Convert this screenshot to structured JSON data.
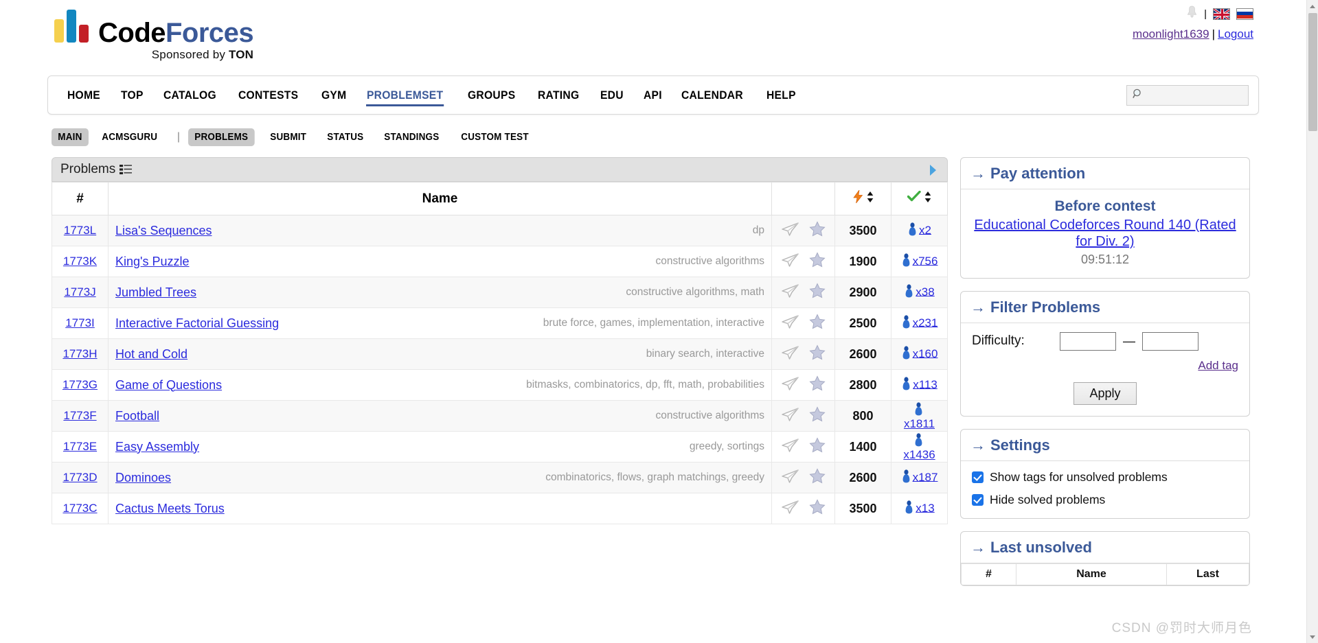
{
  "brand": {
    "name_code": "Code",
    "name_forces": "Forces",
    "sponsor_prefix": "Sponsored by ",
    "sponsor_name": "TON",
    "colors": {
      "yellow": "#f5d04e",
      "blue": "#1287c0",
      "red": "#c32027",
      "forces_blue": "#3b5998"
    }
  },
  "user": {
    "bell_icon": "bell-icon",
    "flag_en": "uk-flag-icon",
    "flag_ru": "russia-flag-icon",
    "username": "moonlight1639",
    "separator": "|",
    "logout": "Logout"
  },
  "nav": {
    "items": [
      {
        "label": "HOME",
        "active": false
      },
      {
        "label": "TOP",
        "active": false
      },
      {
        "label": "CATALOG",
        "active": false
      },
      {
        "label": "CONTESTS",
        "active": false
      },
      {
        "label": "GYM",
        "active": false
      },
      {
        "label": "PROBLEMSET",
        "active": true
      },
      {
        "label": "GROUPS",
        "active": false
      },
      {
        "label": "RATING",
        "active": false
      },
      {
        "label": "EDU",
        "active": false
      },
      {
        "label": "API",
        "active": false
      },
      {
        "label": "CALENDAR",
        "active": false
      },
      {
        "label": "HELP",
        "active": false
      }
    ],
    "search": {
      "placeholder": "",
      "value": "",
      "icon": "search-icon"
    }
  },
  "subnav": {
    "left": [
      {
        "label": "MAIN",
        "selected": true
      },
      {
        "label": "ACMSGURU",
        "selected": false
      }
    ],
    "divider": "|",
    "right": [
      {
        "label": "PROBLEMS",
        "selected": true
      },
      {
        "label": "SUBMIT",
        "selected": false
      },
      {
        "label": "STATUS",
        "selected": false
      },
      {
        "label": "STANDINGS",
        "selected": false
      },
      {
        "label": "CUSTOM TEST",
        "selected": false
      }
    ]
  },
  "problems_panel": {
    "caption": "Problems",
    "caption_icon": "list-icon",
    "next_arrow_icon": "play-arrow-icon",
    "columns": {
      "id": "#",
      "name": "Name",
      "actions": "",
      "difficulty_icon": "lightning-icon",
      "solved_icon": "green-check-icon",
      "sort_icon": "sort-updown-icon"
    },
    "rows": [
      {
        "id": "1773L",
        "name": "Lisa's Sequences",
        "tags": "dp",
        "difficulty": "3500",
        "solved": "x2",
        "stacked": false
      },
      {
        "id": "1773K",
        "name": "King's Puzzle",
        "tags": "constructive algorithms",
        "difficulty": "1900",
        "solved": "x756",
        "stacked": false
      },
      {
        "id": "1773J",
        "name": "Jumbled Trees",
        "tags": "constructive algorithms, math",
        "difficulty": "2900",
        "solved": "x38",
        "stacked": false
      },
      {
        "id": "1773I",
        "name": "Interactive Factorial Guessing",
        "tags": "brute force, games, implementation, interactive",
        "difficulty": "2500",
        "solved": "x231",
        "stacked": false
      },
      {
        "id": "1773H",
        "name": "Hot and Cold",
        "tags": "binary search, interactive",
        "difficulty": "2600",
        "solved": "x160",
        "stacked": false
      },
      {
        "id": "1773G",
        "name": "Game of Questions",
        "tags": "bitmasks, combinatorics, dp, fft, math, probabilities",
        "difficulty": "2800",
        "solved": "x113",
        "stacked": false
      },
      {
        "id": "1773F",
        "name": "Football",
        "tags": "constructive algorithms",
        "difficulty": "800",
        "solved": "x1811",
        "stacked": true
      },
      {
        "id": "1773E",
        "name": "Easy Assembly",
        "tags": "greedy, sortings",
        "difficulty": "1400",
        "solved": "x1436",
        "stacked": true
      },
      {
        "id": "1773D",
        "name": "Dominoes",
        "tags": "combinatorics, flows, graph matchings, greedy",
        "difficulty": "2600",
        "solved": "x187",
        "stacked": false
      },
      {
        "id": "1773C",
        "name": "Cactus Meets Torus",
        "tags": "",
        "difficulty": "3500",
        "solved": "x13",
        "stacked": false
      }
    ]
  },
  "sidebar": {
    "pay_attention": {
      "title": "Pay attention",
      "arrow": "→",
      "before_contest": "Before contest",
      "contest_name": "Educational Codeforces Round 140 (Rated for Div. 2)",
      "timer": "09:51:12"
    },
    "filter_problems": {
      "title": "Filter Problems",
      "arrow": "→",
      "difficulty_label": "Difficulty:",
      "min_value": "",
      "max_value": "",
      "min_placeholder": "",
      "max_placeholder": "",
      "dash": "—",
      "add_tag": "Add tag",
      "apply": "Apply"
    },
    "settings": {
      "title": "Settings",
      "arrow": "→",
      "options": [
        {
          "label": "Show tags for unsolved problems",
          "checked": true
        },
        {
          "label": "Hide solved problems",
          "checked": true
        }
      ]
    },
    "last_unsolved": {
      "title": "Last unsolved",
      "arrow": "→",
      "columns": [
        "#",
        "Name",
        "Last"
      ]
    }
  },
  "watermark": "CSDN @罚时大师月色"
}
